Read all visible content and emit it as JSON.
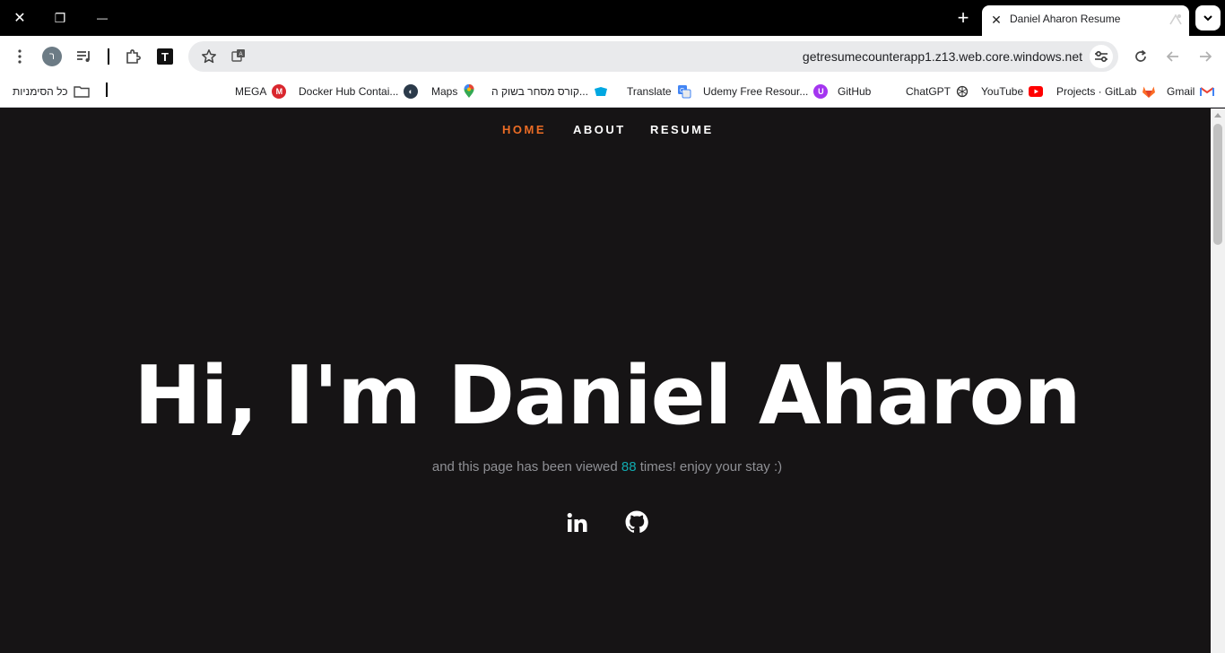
{
  "window": {
    "close_glyph": "✕",
    "restore_glyph": "❐",
    "minimize_glyph": "—",
    "newtab_glyph": "+"
  },
  "tab": {
    "close_glyph": "✕",
    "title": "Daniel Aharon Resume"
  },
  "toolbar": {
    "profile_initial": "ר",
    "extension_T": "T",
    "url": "getresumecounterapp1.z13.web.core.windows.net"
  },
  "bookmarks": {
    "all_bookmarks": "כל הסימניות",
    "items": [
      {
        "label": "MEGA",
        "icon": "mega-icon",
        "color": "#d9272e"
      },
      {
        "label": "Docker Hub Contai...",
        "icon": "docker-icon",
        "color": "#2b3a4a"
      },
      {
        "label": "Maps",
        "icon": "maps-icon",
        "color": "#34a853"
      },
      {
        "label": "קורס מסחר בשוק ה...",
        "icon": "course-icon",
        "color": "#00a7e1"
      },
      {
        "label": "Translate",
        "icon": "translate-icon",
        "color": "#4285f4"
      },
      {
        "label": "Udemy Free Resour...",
        "icon": "udemy-icon",
        "color": "#a435f0"
      },
      {
        "label": "GitHub",
        "icon": "github-icon",
        "color": "#ffffff"
      },
      {
        "label": "ChatGPT",
        "icon": "chatgpt-icon",
        "color": "#333333"
      },
      {
        "label": "YouTube",
        "icon": "youtube-icon",
        "color": "#ff0000"
      },
      {
        "label": "Projects · GitLab",
        "icon": "gitlab-icon",
        "color": "#fc6d26"
      },
      {
        "label": "Gmail",
        "icon": "gmail-icon",
        "color": "#ea4335"
      }
    ]
  },
  "page": {
    "nav": {
      "home": "HOME",
      "about": "ABOUT",
      "resume": "RESUME",
      "active_color": "#eb6c25"
    },
    "hero_title": "Hi, I'm Daniel Aharon",
    "subtitle_before": "and this page has been viewed ",
    "view_count": "88",
    "subtitle_after": " times! enjoy your stay :)",
    "socials": [
      "linkedin-icon",
      "github-icon"
    ]
  }
}
